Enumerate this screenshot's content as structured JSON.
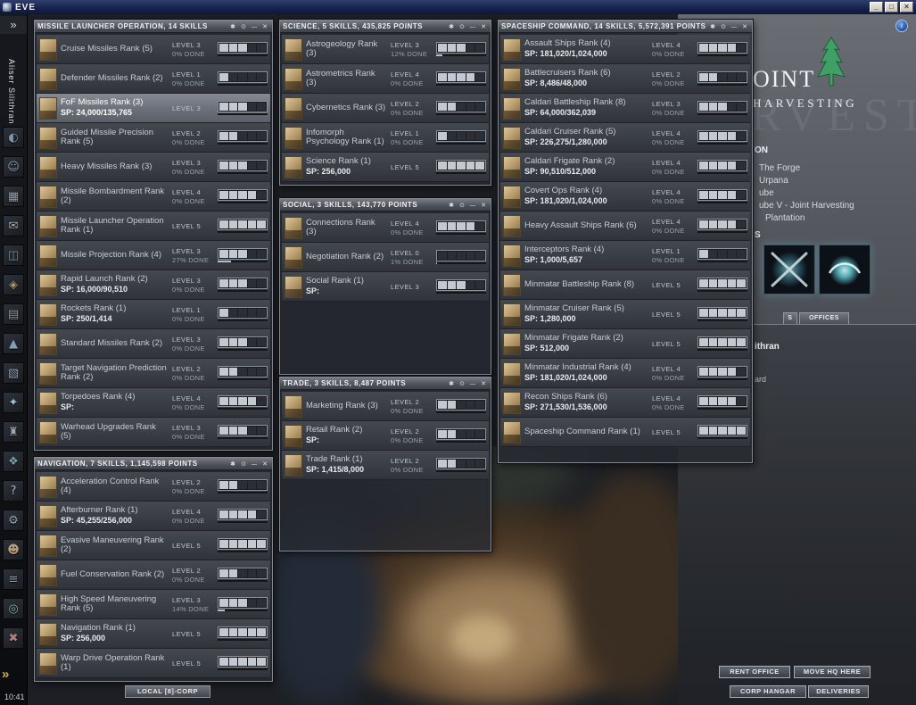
{
  "os_titlebar": {
    "app_title": "EVE",
    "minimize_label": "_",
    "maximize_label": "□",
    "close_label": "✕"
  },
  "window_chrome": {
    "pin": "✱",
    "shade": "⊙",
    "minimize": "—",
    "close": "✕"
  },
  "neocom": {
    "expand_top": "»",
    "expand_bottom": "»",
    "character_name": "Aliser Silithran",
    "clock": "10:41",
    "icons": [
      {
        "name": "map-icon",
        "glyph": "◐",
        "tint": "#7f93a8"
      },
      {
        "name": "people-places-icon",
        "glyph": "☺",
        "tint": "#8fa0b0"
      },
      {
        "name": "assets-icon",
        "glyph": "▦",
        "tint": "#98a3ad"
      },
      {
        "name": "mail-icon",
        "glyph": "✉",
        "tint": "#a8b2bc"
      },
      {
        "name": "market-icon",
        "glyph": "◫",
        "tint": "#7f98a0"
      },
      {
        "name": "wallet-icon",
        "glyph": "◈",
        "tint": "#a89a6e"
      },
      {
        "name": "items-icon",
        "glyph": "▤",
        "tint": "#8d98a2"
      },
      {
        "name": "ships-icon",
        "glyph": "▲",
        "tint": "#7fa0b5"
      },
      {
        "name": "journal-icon",
        "glyph": "▧",
        "tint": "#93a0ab"
      },
      {
        "name": "skills-icon",
        "glyph": "✦",
        "tint": "#9fc0c8"
      },
      {
        "name": "corporation-icon",
        "glyph": "♜",
        "tint": "#a0a8b2"
      },
      {
        "name": "science-icon",
        "glyph": "❖",
        "tint": "#79a3ab"
      },
      {
        "name": "help-icon",
        "glyph": "?",
        "tint": "#b0b8c2"
      },
      {
        "name": "settings-icon",
        "glyph": "⚙",
        "tint": "#9aa4ae"
      },
      {
        "name": "character-icon",
        "glyph": "☻",
        "tint": "#b59a7e"
      },
      {
        "name": "chat-icon",
        "glyph": "≡",
        "tint": "#8f9aa5"
      },
      {
        "name": "scanner-icon",
        "glyph": "◎",
        "tint": "#84b0a8"
      },
      {
        "name": "exit-icon",
        "glyph": "✖",
        "tint": "#b08080"
      }
    ]
  },
  "chat_tab": {
    "label": "LOCAL [8]-CORP"
  },
  "windows": [
    {
      "id": "missile",
      "title": "MISSILE LAUNCHER OPERATION, 14 SKILLS",
      "skills": [
        {
          "name": "Cruise Missiles Rank (5)",
          "level_label": "LEVEL 3",
          "level": 3,
          "status": "0% DONE",
          "pct": 0
        },
        {
          "name": "Defender Missiles Rank (2)",
          "level_label": "LEVEL 1",
          "level": 1,
          "status": "0% DONE",
          "pct": 0
        },
        {
          "name": "FoF Missiles Rank (3)",
          "sp": "SP: 24,000/135,765",
          "level_label": "LEVEL 3",
          "level": 3,
          "selected": true,
          "pct": 0
        },
        {
          "name": "Guided Missile Precision Rank (5)",
          "level_label": "LEVEL 2",
          "level": 2,
          "status": "0% DONE",
          "pct": 0
        },
        {
          "name": "Heavy Missiles Rank (3)",
          "level_label": "LEVEL 3",
          "level": 3,
          "status": "0% DONE",
          "pct": 0
        },
        {
          "name": "Missile Bombardment Rank (2)",
          "level_label": "LEVEL 4",
          "level": 4,
          "status": "0% DONE",
          "pct": 0
        },
        {
          "name": "Missile Launcher Operation Rank (1)",
          "level_label": "LEVEL 5",
          "level": 5,
          "pct": 0
        },
        {
          "name": "Missile Projection Rank (4)",
          "level_label": "LEVEL 3",
          "level": 3,
          "status": "27% DONE",
          "pct": 27
        },
        {
          "name": "Rapid Launch Rank (2)",
          "sp": "SP: 16,000/90,510",
          "level_label": "LEVEL 3",
          "level": 3,
          "status": "0% DONE",
          "pct": 0
        },
        {
          "name": "Rockets Rank (1)",
          "sp": "SP: 250/1,414",
          "level_label": "LEVEL 1",
          "level": 1,
          "status": "0% DONE",
          "pct": 0
        },
        {
          "name": "Standard Missiles Rank (2)",
          "level_label": "LEVEL 3",
          "level": 3,
          "status": "0% DONE",
          "pct": 0
        },
        {
          "name": "Target Navigation Prediction Rank (2)",
          "level_label": "LEVEL 2",
          "level": 2,
          "status": "0% DONE",
          "pct": 0
        },
        {
          "name": "Torpedoes Rank (4)",
          "sp": "SP:",
          "level_label": "LEVEL 4",
          "level": 4,
          "status": "0% DONE",
          "pct": 0
        },
        {
          "name": "Warhead Upgrades Rank (5)",
          "level_label": "LEVEL 3",
          "level": 3,
          "status": "0% DONE",
          "pct": 0
        }
      ]
    },
    {
      "id": "navigation",
      "title": "NAVIGATION, 7 SKILLS, 1,145,598 POINTS",
      "skills": [
        {
          "name": "Acceleration Control Rank (4)",
          "level_label": "LEVEL 2",
          "level": 2,
          "status": "0% DONE",
          "pct": 0
        },
        {
          "name": "Afterburner Rank (1)",
          "sp": "SP: 45,255/256,000",
          "level_label": "LEVEL 4",
          "level": 4,
          "status": "0% DONE",
          "pct": 0
        },
        {
          "name": "Evasive Maneuvering Rank (2)",
          "level_label": "LEVEL 5",
          "level": 5,
          "pct": 0
        },
        {
          "name": "Fuel Conservation Rank (2)",
          "level_label": "LEVEL 2",
          "level": 2,
          "status": "0% DONE",
          "pct": 0
        },
        {
          "name": "High Speed Maneuvering Rank (5)",
          "level_label": "LEVEL 3",
          "level": 3,
          "status": "14% DONE",
          "pct": 14
        },
        {
          "name": "Navigation Rank (1)",
          "sp": "SP: 256,000",
          "level_label": "LEVEL 5",
          "level": 5,
          "pct": 0
        },
        {
          "name": "Warp Drive Operation Rank (1)",
          "level_label": "LEVEL 5",
          "level": 5,
          "pct": 0
        }
      ]
    },
    {
      "id": "science",
      "title": "SCIENCE, 5 SKILLS, 435,825 POINTS",
      "skills": [
        {
          "name": "Astrogeology Rank (3)",
          "level_label": "LEVEL 3",
          "level": 3,
          "status": "12% DONE",
          "pct": 12
        },
        {
          "name": "Astrometrics Rank (3)",
          "level_label": "LEVEL 4",
          "level": 4,
          "status": "0% DONE",
          "pct": 0
        },
        {
          "name": "Cybernetics Rank (3)",
          "level_label": "LEVEL 2",
          "level": 2,
          "status": "0% DONE",
          "pct": 0
        },
        {
          "name": "Infomorph Psychology Rank (1)",
          "level_label": "LEVEL 1",
          "level": 1,
          "status": "0% DONE",
          "pct": 0
        },
        {
          "name": "Science Rank (1)",
          "sp": "SP: 256,000",
          "level_label": "LEVEL 5",
          "level": 5,
          "pct": 0
        }
      ]
    },
    {
      "id": "social",
      "title": "SOCIAL, 3 SKILLS, 143,770 POINTS",
      "skills": [
        {
          "name": "Connections Rank (3)",
          "level_label": "LEVEL 4",
          "level": 4,
          "status": "0% DONE",
          "pct": 0
        },
        {
          "name": "Negotiation Rank (2)",
          "level_label": "LEVEL 0",
          "level": 0,
          "status": "1% DONE",
          "pct": 1
        },
        {
          "name": "Social Rank (1)",
          "sp": "SP:",
          "level_label": "LEVEL 3",
          "level": 3,
          "pct": 0
        }
      ]
    },
    {
      "id": "trade",
      "title": "TRADE, 3 SKILLS, 8,487 POINTS",
      "skills": [
        {
          "name": "Marketing Rank (3)",
          "level_label": "LEVEL 2",
          "level": 2,
          "status": "0% DONE",
          "pct": 0
        },
        {
          "name": "Retail Rank (2)",
          "sp": "SP:",
          "level_label": "LEVEL 2",
          "level": 2,
          "status": "0% DONE",
          "pct": 0
        },
        {
          "name": "Trade Rank (1)",
          "sp": "SP: 1,415/8,000",
          "level_label": "LEVEL 2",
          "level": 2,
          "status": "0% DONE",
          "pct": 0
        }
      ]
    },
    {
      "id": "spaceship",
      "title": "SPACESHIP COMMAND, 14 SKILLS, 5,572,391 POINTS",
      "skills": [
        {
          "name": "Assault Ships Rank (4)",
          "sp": "SP: 181,020/1,024,000",
          "level_label": "LEVEL 4",
          "level": 4,
          "status": "0% DONE",
          "pct": 0
        },
        {
          "name": "Battlecruisers Rank (6)",
          "sp": "SP: 8,486/48,000",
          "level_label": "LEVEL 2",
          "level": 2,
          "status": "0% DONE",
          "pct": 0
        },
        {
          "name": "Caldari Battleship Rank (8)",
          "sp": "SP: 64,000/362,039",
          "level_label": "LEVEL 3",
          "level": 3,
          "status": "0% DONE",
          "pct": 0
        },
        {
          "name": "Caldari Cruiser Rank (5)",
          "sp": "SP: 226,275/1,280,000",
          "level_label": "LEVEL 4",
          "level": 4,
          "status": "0% DONE",
          "pct": 0
        },
        {
          "name": "Caldari Frigate Rank (2)",
          "sp": "SP: 90,510/512,000",
          "level_label": "LEVEL 4",
          "level": 4,
          "status": "0% DONE",
          "pct": 0
        },
        {
          "name": "Covert Ops Rank (4)",
          "sp": "SP: 181,020/1,024,000",
          "level_label": "LEVEL 4",
          "level": 4,
          "status": "0% DONE",
          "pct": 0
        },
        {
          "name": "Heavy Assault Ships Rank (6)",
          "level_label": "LEVEL 4",
          "level": 4,
          "status": "0% DONE",
          "pct": 0
        },
        {
          "name": "Interceptors Rank (4)",
          "sp": "SP: 1,000/5,657",
          "level_label": "LEVEL 1",
          "level": 1,
          "status": "0% DONE",
          "pct": 0
        },
        {
          "name": "Minmatar Battleship Rank (8)",
          "level_label": "LEVEL 5",
          "level": 5,
          "pct": 0
        },
        {
          "name": "Minmatar Cruiser Rank (5)",
          "sp": "SP: 1,280,000",
          "level_label": "LEVEL 5",
          "level": 5,
          "pct": 0
        },
        {
          "name": "Minmatar Frigate Rank (2)",
          "sp": "SP: 512,000",
          "level_label": "LEVEL 5",
          "level": 5,
          "pct": 0
        },
        {
          "name": "Minmatar Industrial Rank (4)",
          "sp": "SP: 181,020/1,024,000",
          "level_label": "LEVEL 4",
          "level": 4,
          "status": "0% DONE",
          "pct": 0
        },
        {
          "name": "Recon Ships Rank (6)",
          "sp": "SP: 271,530/1,536,000",
          "level_label": "LEVEL 4",
          "level": 4,
          "status": "0% DONE",
          "pct": 0
        },
        {
          "name": "Spaceship Command Rank (1)",
          "level_label": "LEVEL 5",
          "level": 5,
          "pct": 0
        }
      ]
    }
  ],
  "station_panel": {
    "corp_name_fragment": "OINT",
    "corp_name_line2": "HARVESTING",
    "watermark": "HARVESTING",
    "info_label": "i",
    "location_fragments": [
      "ON",
      "The Forge",
      "Urpana",
      "ube",
      "ube V - Joint Harvesting",
      "Plantation",
      "S"
    ],
    "tabs": [
      "S",
      "OFFICES"
    ],
    "text_fragments": [
      "ithran",
      "ard"
    ],
    "buttons": [
      "RENT OFFICE",
      "MOVE HQ HERE",
      "CORP HANGAR",
      "DELIVERIES"
    ],
    "accent_green": "#3fa065"
  }
}
